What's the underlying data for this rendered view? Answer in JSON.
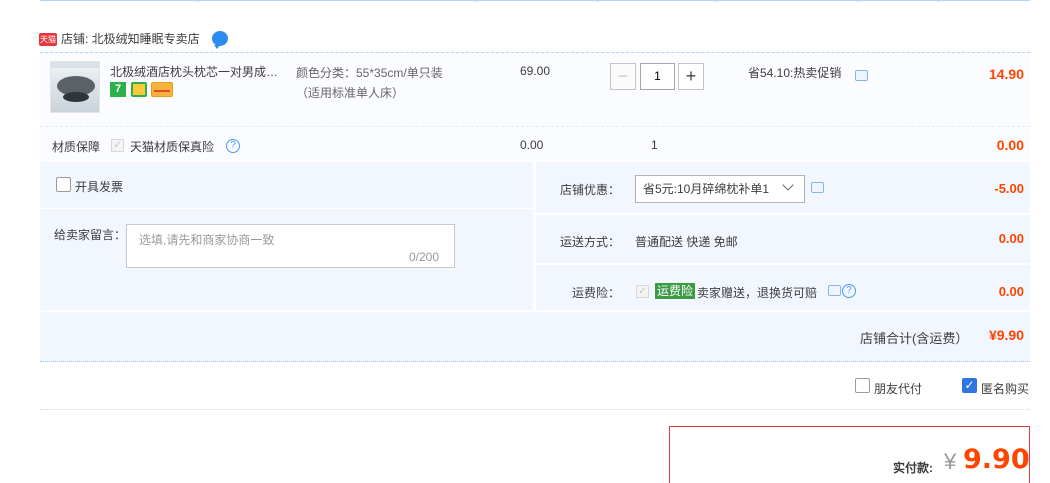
{
  "shop": {
    "badge": "天猫",
    "label": "店铺: 北极绒知睡眠专卖店"
  },
  "item": {
    "title": "北极绒酒店枕头枕芯一对男成人家用单人学生宿舍颈椎助睡眠整头",
    "sku_line1": "颜色分类：55*35cm/单只装",
    "sku_line2": "（适用标准单人床）",
    "price": "69.00",
    "qty": "1",
    "promo": "省54.10:热卖促销",
    "subtotal": "14.90",
    "tag7": "7"
  },
  "insurance": {
    "label": "材质保障",
    "text": "天猫材质保真险",
    "price": "0.00",
    "qty": "1",
    "amount": "0.00"
  },
  "left_panel": {
    "invoice_label": "开具发票",
    "message_label": "给卖家留言：",
    "message_placeholder": "选填,请先和商家协商一致",
    "message_count": "0/200"
  },
  "right_panel": {
    "coupon_label": "店铺优惠：",
    "coupon_value": "省5元:10月碎绵枕补单1",
    "coupon_amount": "-5.00",
    "shipping_label": "运送方式：",
    "shipping_value": "普通配送 快递 免邮",
    "shipping_amount": "0.00",
    "freight_label": "运费险：",
    "freight_tag": "运费险",
    "freight_text": "卖家赠送，退换货可赔",
    "freight_amount": "0.00"
  },
  "totals": {
    "shop_total_label": "店铺合计(含运费）",
    "shop_total": "¥9.90",
    "friend_pay_label": "朋友代付",
    "anonymous_label": "匿名购买",
    "pay_label": "实付款:",
    "pay_currency": "¥",
    "pay_amount": "9.90"
  },
  "colors": {
    "accent_red": "#ff4400",
    "panel_blue": "#f2f7ff",
    "checkbox_blue": "#2f76e3"
  }
}
